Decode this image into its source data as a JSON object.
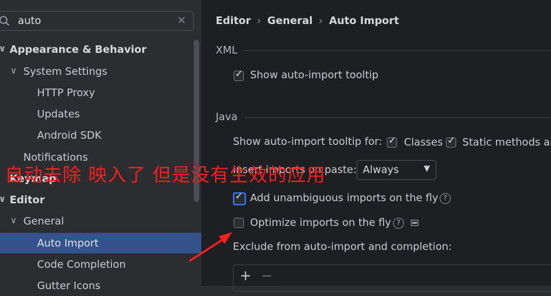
{
  "search": {
    "value": "auto"
  },
  "tree": [
    {
      "label": "Appearance & Behavior",
      "bold": true
    },
    {
      "label": "System Settings"
    },
    {
      "label": "HTTP Proxy"
    },
    {
      "label": "Updates"
    },
    {
      "label": "Android SDK"
    },
    {
      "label": "Notifications"
    },
    {
      "label": "Keymap",
      "bold": true
    },
    {
      "label": "Editor",
      "bold": true
    },
    {
      "label": "General"
    },
    {
      "label": "Auto Import"
    },
    {
      "label": "Code Completion"
    },
    {
      "label": "Gutter Icons"
    }
  ],
  "breadcrumb": {
    "editor": "Editor",
    "general": "General",
    "page": "Auto Import"
  },
  "xml": {
    "title": "XML",
    "show_tooltip": "Show auto-import tooltip",
    "show_tooltip_checked": true
  },
  "java": {
    "title": "Java",
    "tooltip_for": "Show auto-import tooltip for:",
    "classes": "Classes",
    "classes_checked": true,
    "static_methods": "Static methods an",
    "static_methods_checked": true,
    "insert_on_paste": "Insert imports on paste:",
    "insert_on_paste_value": "Always",
    "add_unambiguous": "Add unambiguous imports on the fly",
    "add_unambiguous_checked": true,
    "optimize": "Optimize imports on the fly",
    "optimize_checked": false,
    "exclude": "Exclude from auto-import and completion:",
    "add_btn": "+",
    "remove_btn": "−"
  },
  "annotation": {
    "text": "自动去除 映入了 但是没有生效的应用"
  },
  "colors": {
    "annotation": "#f51f1f",
    "selection": "#2e436e",
    "focus": "#3574f0"
  }
}
